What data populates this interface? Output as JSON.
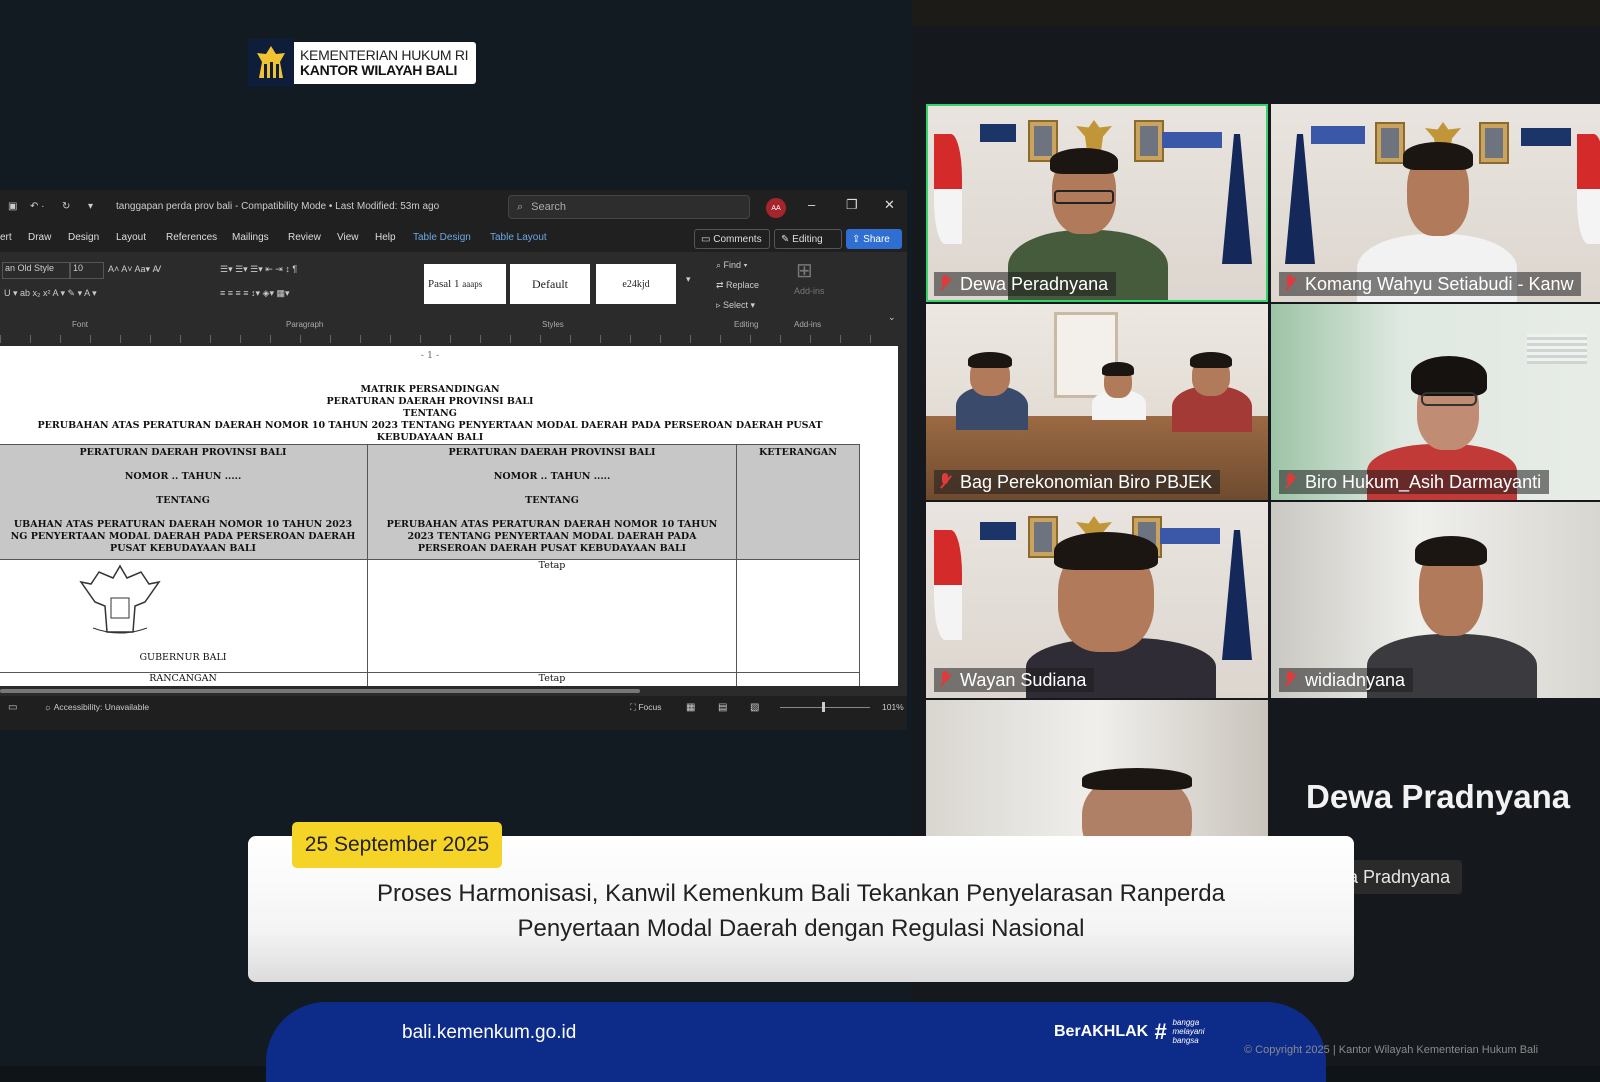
{
  "logo": {
    "line1": "KEMENTERIAN HUKUM RI",
    "line2": "KANTOR WILAYAH BALI"
  },
  "word": {
    "title": "tanggapan perda prov bali  -  Compatibility Mode  •  Last Modified: 53m ago",
    "search_placeholder": "Search",
    "avatar_initials": "AA",
    "menu": [
      "ert",
      "Draw",
      "Design",
      "Layout",
      "References",
      "Mailings",
      "Review",
      "View",
      "Help",
      "Table Design",
      "Table Layout"
    ],
    "buttons": {
      "comments": "Comments",
      "editing": "Editing",
      "share": "Share"
    },
    "ribbon": {
      "font_name": "an Old Style",
      "font_size": "10",
      "styles": [
        "Pasal 1",
        "aaaps",
        "Default",
        "e24kjd"
      ],
      "find": "Find",
      "replace": "Replace",
      "select": "Select",
      "addins": "Add-ins",
      "groups": [
        "Font",
        "Paragraph",
        "Styles",
        "Editing",
        "Add-ins"
      ]
    },
    "document": {
      "page_marker": "- 1 -",
      "heading": [
        "MATRIK PERSANDINGAN",
        "PERATURAN DAERAH PROVINSI BALI",
        "TENTANG",
        "PERUBAHAN ATAS PERATURAN DAERAH NOMOR 10 TAHUN 2023 TENTANG PENYERTAAN MODAL DAERAH PADA PERSEROAN DAERAH PUSAT",
        "KEBUDAYAAN BALI"
      ],
      "col1": [
        "PERATURAN DAERAH PROVINSI BALI",
        "NOMOR .. TAHUN .....",
        "TENTANG",
        "UBAHAN ATAS PERATURAN DAERAH NOMOR 10 TAHUN 2023",
        "NG PENYERTAAN MODAL DAERAH PADA PERSEROAN DAERAH",
        "PUSAT KEBUDAYAAN BALI"
      ],
      "col2": [
        "PERATURAN DAERAH PROVINSI BALI",
        "NOMOR .. TAHUN .....",
        "TENTANG",
        "PERUBAHAN ATAS PERATURAN DAERAH NOMOR 10 TAHUN",
        "2023 TENTANG PENYERTAAN MODAL DAERAH PADA",
        "PERSEROAN DAERAH PUSAT KEBUDAYAAN BALI"
      ],
      "col3": "KETERANGAN",
      "row2_col1": "GUBERNUR BALI",
      "row2_col2": "Tetap",
      "row3_col1": "RANCANGAN",
      "row3_col2": "Tetap"
    },
    "status": {
      "accessibility": "Accessibility: Unavailable",
      "focus": "Focus",
      "zoom": "101%"
    }
  },
  "participants": [
    {
      "name": "Dewa Peradnyana",
      "active": true
    },
    {
      "name": "Komang Wahyu Setiabudi - Kanw"
    },
    {
      "name": "Bag Perekonomian Biro PBJEK"
    },
    {
      "name": "Biro Hukum_Asih Darmayanti"
    },
    {
      "name": "Wayan Sudiana"
    },
    {
      "name": "widiadnyana"
    }
  ],
  "speaker": {
    "big_name": "Dewa Pradnyana",
    "label": "a Pradnyana"
  },
  "caption": {
    "date": "25 September 2025",
    "headline_line1": "Proses Harmonisasi, Kanwil Kemenkum Bali Tekankan Penyelarasan Ranperda",
    "headline_line2": "Penyertaan Modal Daerah dengan Regulasi Nasional"
  },
  "footer": {
    "site": "bali.kemenkum.go.id",
    "berakhlak": "BerAKHLAK",
    "tagline": [
      "bangga",
      "melayani",
      "bangsa"
    ],
    "copyright": "© Copyright 2025 | Kantor Wilayah Kementerian Hukum Bali"
  },
  "colors": {
    "accent_yellow": "#f5d327",
    "footer_blue": "#0d2c8a",
    "active_speaker": "#35d36b",
    "word_blue": "#2f6fd1"
  }
}
